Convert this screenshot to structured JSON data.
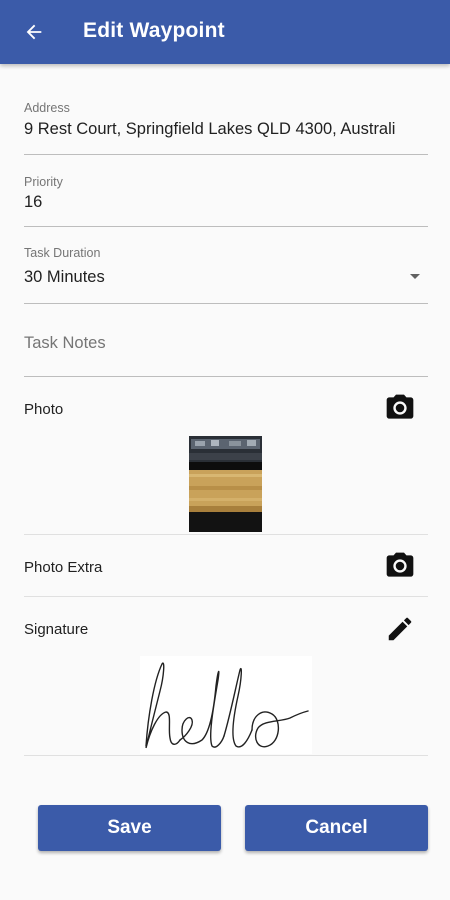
{
  "appbar": {
    "title": "Edit Waypoint",
    "back_icon": "arrow-left-icon",
    "color": "#3b5ba9"
  },
  "address": {
    "label": "Address",
    "value": "9 Rest Court, Springfield Lakes QLD 4300, Australi"
  },
  "priority": {
    "label": "Priority",
    "value": "16"
  },
  "task_duration": {
    "label": "Task Duration",
    "selected": "30 Minutes"
  },
  "task_notes": {
    "placeholder": "Task Notes"
  },
  "photo": {
    "label": "Photo",
    "icon": "camera-icon"
  },
  "photo_extra": {
    "label": "Photo Extra",
    "icon": "camera-icon"
  },
  "signature": {
    "label": "Signature",
    "icon": "pencil-icon",
    "handwritten_text": "hello"
  },
  "buttons": {
    "save": "Save",
    "cancel": "Cancel"
  }
}
